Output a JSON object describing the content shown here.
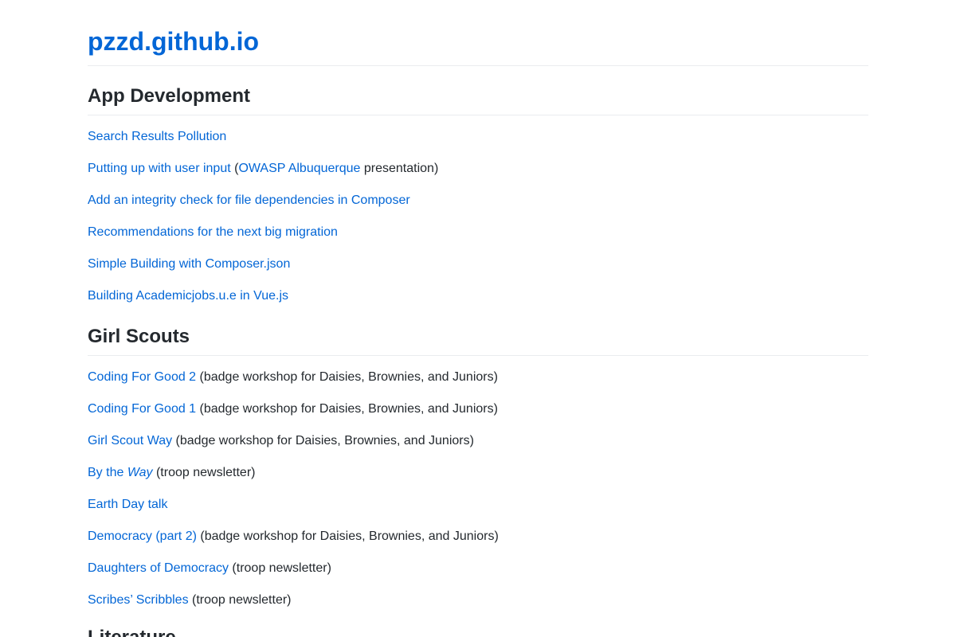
{
  "site": {
    "title": "pzzd.github.io"
  },
  "colors": {
    "link": "#0366d6",
    "text": "#24292e",
    "rule": "#eaecef"
  },
  "sections": [
    {
      "title": "App Development",
      "items": [
        {
          "link": "Search Results Pollution"
        },
        {
          "link": "Putting up with user input",
          "open": " (",
          "link2": "OWASP Albuquerque",
          "note": " presentation)"
        },
        {
          "link": "Add an integrity check for file dependencies in Composer"
        },
        {
          "link": "Recommendations for the next big migration"
        },
        {
          "link": "Simple Building with Composer.json"
        },
        {
          "link": "Building Academicjobs.u.e in Vue.js"
        }
      ]
    },
    {
      "title": "Girl Scouts",
      "items": [
        {
          "link": "Coding For Good 2",
          "note": " (badge workshop for Daisies, Brownies, and Juniors)"
        },
        {
          "link": "Coding For Good 1",
          "note": " (badge workshop for Daisies, Brownies, and Juniors)"
        },
        {
          "link": "Girl Scout Way",
          "note": " (badge workshop for Daisies, Brownies, and Juniors)"
        },
        {
          "link": "By the ",
          "link_em": "Way",
          "note": " (troop newsletter)"
        },
        {
          "link": "Earth Day talk"
        },
        {
          "link": "Democracy (part 2)",
          "note": " (badge workshop for Daisies, Brownies, and Juniors)"
        },
        {
          "link": "Daughters of Democracy",
          "note": " (troop newsletter)"
        },
        {
          "link": "Scribes’ Scribbles",
          "note": " (troop newsletter)"
        }
      ]
    },
    {
      "title": "Literature"
    }
  ]
}
